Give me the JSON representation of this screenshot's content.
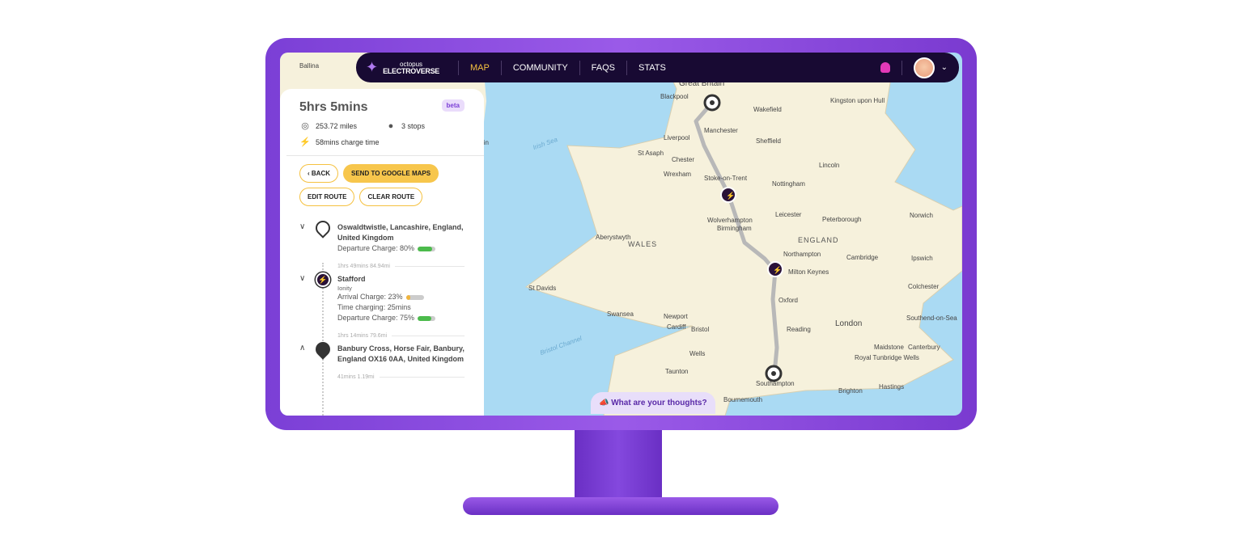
{
  "nav": {
    "logo_top": "octopus",
    "logo_bottom": "ELECTROVERSE",
    "items": [
      "MAP",
      "COMMUNITY",
      "FAQS",
      "STATS"
    ],
    "active": "MAP"
  },
  "route": {
    "duration": "5hrs 5mins",
    "badge": "beta",
    "distance": "253.72 miles",
    "stops": "3 stops",
    "charge_time": "58mins charge time"
  },
  "buttons": {
    "back": "BACK",
    "google": "SEND TO GOOGLE MAPS",
    "edit": "EDIT ROUTE",
    "clear": "CLEAR ROUTE"
  },
  "stops": [
    {
      "name": "Oswaldtwistle, Lancashire, England, United Kingdom",
      "departure": "Departure Charge: 80%",
      "departure_pct": 80
    },
    {
      "leg": "1hrs 49mins 84.94mi",
      "name": "Stafford",
      "network": "Ionity",
      "arrival": "Arrival Charge: 23%",
      "arrival_pct": 23,
      "charging": "Time charging: 25mins",
      "departure": "Departure Charge: 75%",
      "departure_pct": 75
    },
    {
      "leg": "1hrs 14mins 79.6mi",
      "name": "Banbury Cross, Horse Fair, Banbury, England OX16 0AA, United Kingdom"
    },
    {
      "leg": "41mins 1.19mi"
    }
  ],
  "feedback": "What are your thoughts?",
  "map": {
    "labels": [
      "Great Britain",
      "Blackpool",
      "Manchester",
      "Liverpool",
      "Wakefield",
      "Kingston upon Hull",
      "Sheffield",
      "St Asaph",
      "Chester",
      "Wrexham",
      "Stoke-on-Trent",
      "Nottingham",
      "Lincoln",
      "Wolverhampton",
      "Leicester",
      "Peterborough",
      "Norwich",
      "Birmingham",
      "ENGLAND",
      "WALES",
      "Aberystwyth",
      "Northampton",
      "Cambridge",
      "Ipswich",
      "Milton Keynes",
      "Colchester",
      "St Davids",
      "Oxford",
      "Swansea",
      "Newport",
      "Cardiff",
      "Bristol",
      "Reading",
      "London",
      "Southend-on-Sea",
      "Maidstone",
      "Canterbury",
      "Wells",
      "Taunton",
      "Royal Tunbridge Wells",
      "Southampton",
      "Brighton",
      "Hastings",
      "Bournemouth",
      "Irish Sea",
      "Bristol Channel",
      "Ballina",
      "lin"
    ]
  },
  "colors": {
    "accent": "#f5c140",
    "nav_bg": "#180a33",
    "frame": "#8448de",
    "sea": "#aadaf3",
    "land": "#f6f1dc",
    "route": "#b8b8b8"
  }
}
